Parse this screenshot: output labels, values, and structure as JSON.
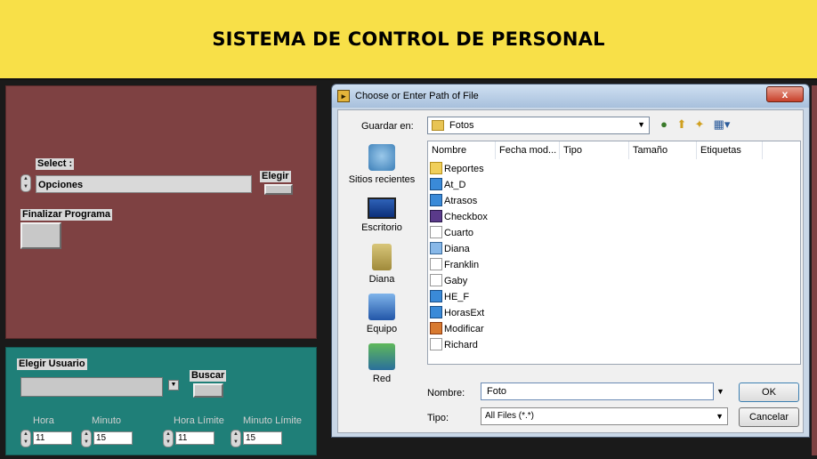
{
  "banner": {
    "title": "SISTEMA DE CONTROL DE PERSONAL"
  },
  "top_panel": {
    "select_label": "Select :",
    "select_value": "Opciones",
    "elegir_label": "Elegir",
    "finalizar_label": "Finalizar Programa"
  },
  "bottom_panel": {
    "elegir_usuario_label": "Elegir Usuario",
    "usuario_value": "",
    "buscar_label": "Buscar",
    "hora_label": "Hora",
    "hora_value": "11",
    "minuto_label": "Minuto",
    "minuto_value": "15",
    "hora_limite_label": "Hora Límite",
    "hora_limite_value": "11",
    "minuto_limite_label": "Minuto Límite",
    "minuto_limite_value": "15"
  },
  "dialog": {
    "title": "Choose or Enter Path of File",
    "close_label": "x",
    "save_in_label": "Guardar en:",
    "save_in_value": "Fotos",
    "places": [
      "Sitios recientes",
      "Escritorio",
      "Diana",
      "Equipo",
      "Red"
    ],
    "columns": [
      "Nombre",
      "Fecha mod...",
      "Tipo",
      "Tamaño",
      "Etiquetas"
    ],
    "files": [
      {
        "name": "Reportes",
        "icon": "folder"
      },
      {
        "name": "At_D",
        "icon": "vi"
      },
      {
        "name": "Atrasos",
        "icon": "vi"
      },
      {
        "name": "Checkbox",
        "icon": "ctl"
      },
      {
        "name": "Cuarto",
        "icon": "file"
      },
      {
        "name": "Diana",
        "icon": "img"
      },
      {
        "name": "Franklin",
        "icon": "file"
      },
      {
        "name": "Gaby",
        "icon": "file"
      },
      {
        "name": "HE_F",
        "icon": "vi"
      },
      {
        "name": "HorasExt",
        "icon": "vi"
      },
      {
        "name": "Modificar",
        "icon": "mod"
      },
      {
        "name": "Richard",
        "icon": "file"
      }
    ],
    "name_label": "Nombre:",
    "name_value": "Foto",
    "type_label": "Tipo:",
    "type_value": "All Files (*.*)",
    "ok_label": "OK",
    "cancel_label": "Cancelar"
  },
  "colors": {
    "banner": "#f8e048",
    "top_panel": "#7e4142",
    "bottom_panel": "#1f7f78"
  }
}
